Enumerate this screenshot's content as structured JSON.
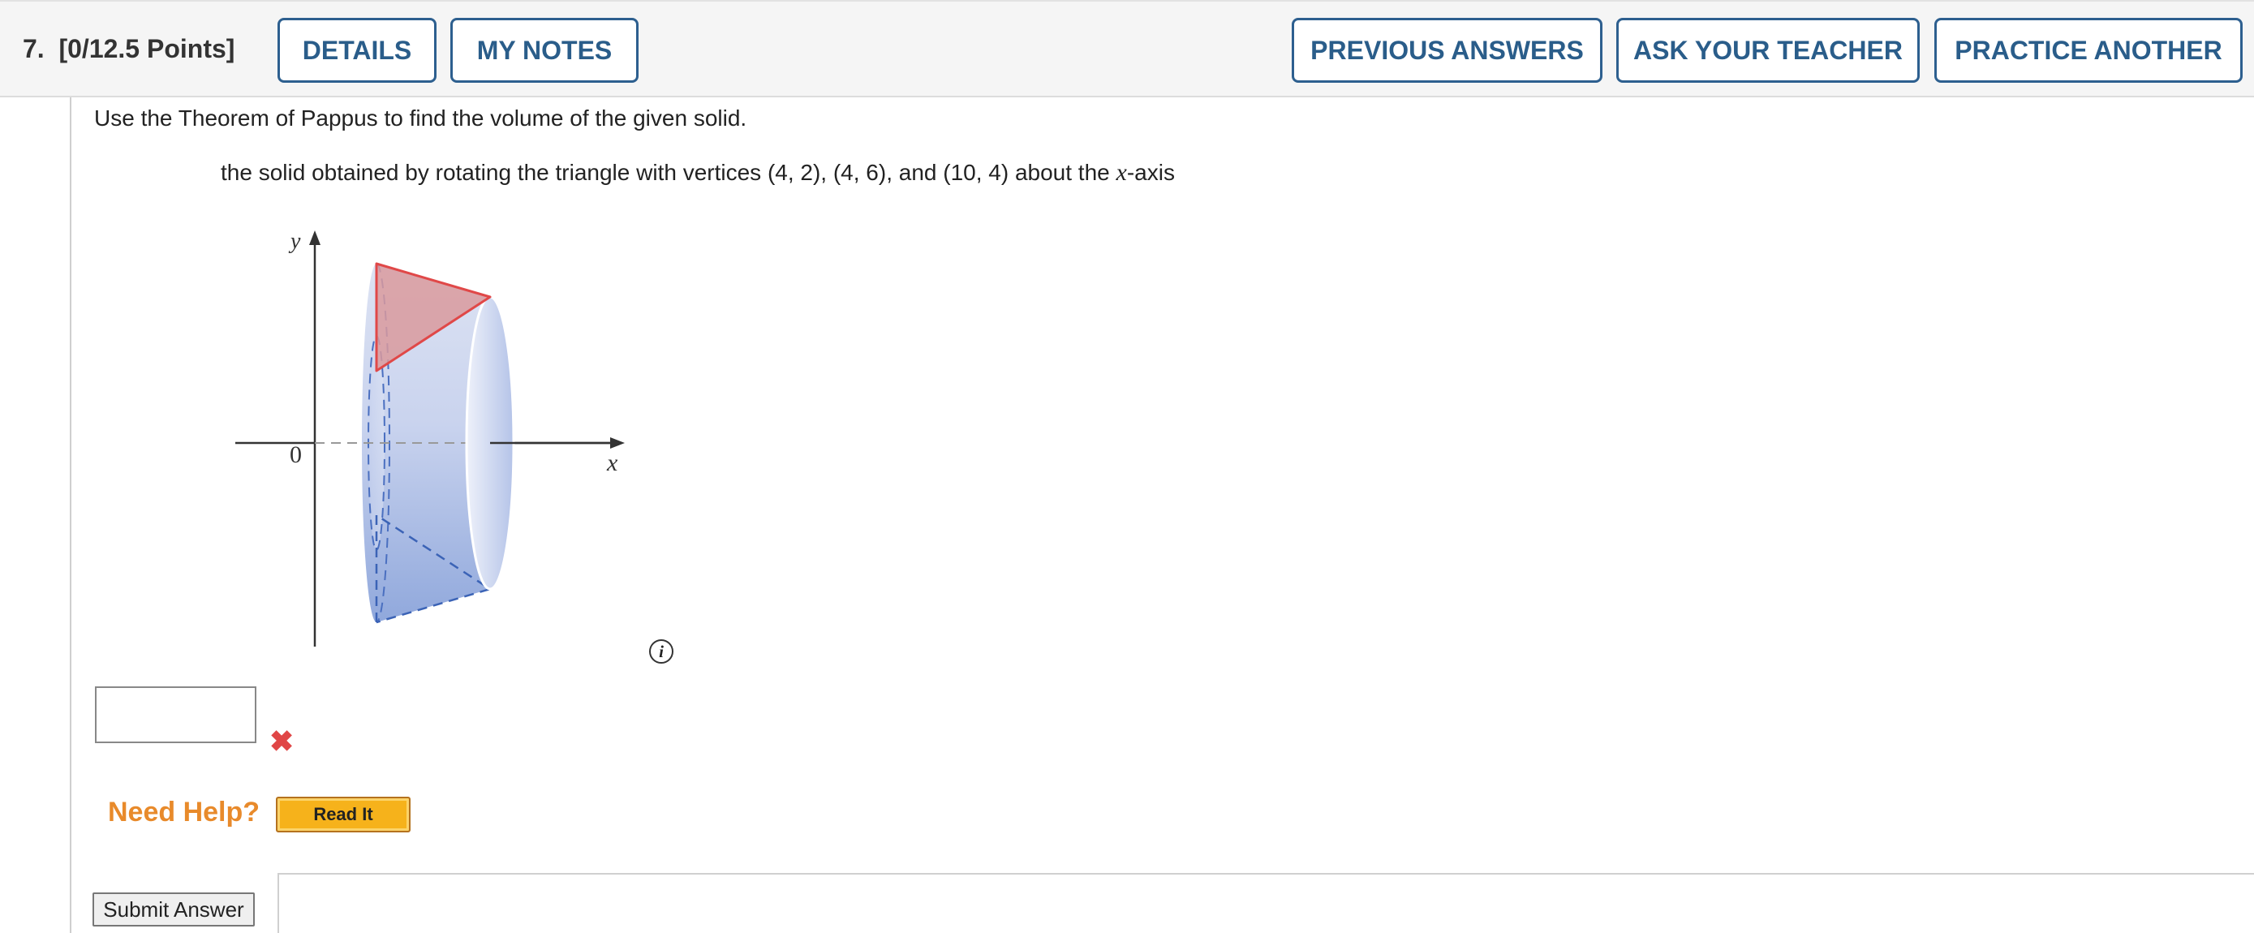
{
  "header": {
    "question_number": "7.",
    "points": "[0/12.5 Points]",
    "buttons": {
      "details": "DETAILS",
      "my_notes": "MY NOTES",
      "previous_answers": "PREVIOUS ANSWERS",
      "ask_teacher": "ASK YOUR TEACHER",
      "practice_another": "PRACTICE ANOTHER"
    }
  },
  "question": {
    "prompt": "Use the Theorem of Pappus to find the volume of the given solid.",
    "description_prefix": "the solid obtained by rotating the triangle with vertices (4, 2), (4, 6), and (10, 4) about the",
    "description_var": "x",
    "description_suffix": "-axis"
  },
  "figure": {
    "y_label": "y",
    "x_label": "x",
    "origin_label": "0",
    "triangle_color": "#e05555",
    "solid_color": "#a9bde6"
  },
  "answer": {
    "value": "",
    "status": "incorrect"
  },
  "help": {
    "label": "Need Help?",
    "read_it": "Read It"
  },
  "submit_label": "Submit Answer"
}
